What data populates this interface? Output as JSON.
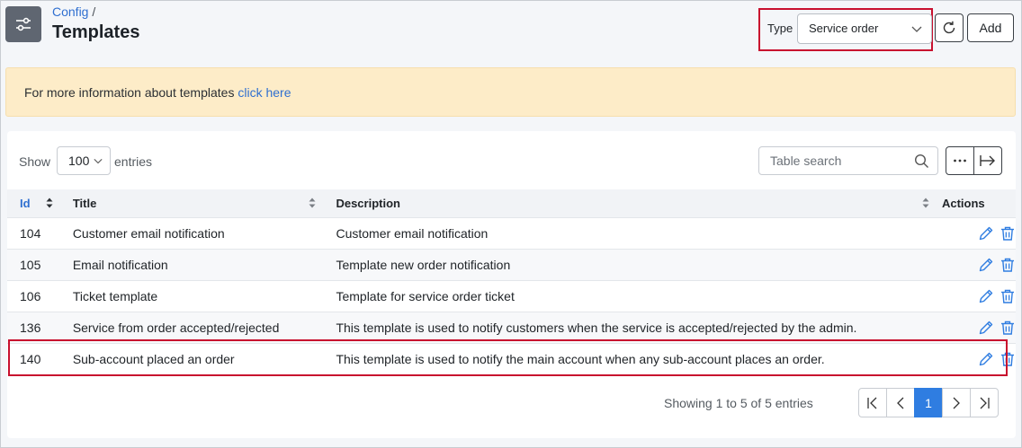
{
  "header": {
    "breadcrumb_parent": "Config",
    "breadcrumb_sep": "/",
    "title": "Templates",
    "type_label": "Type",
    "type_value": "Service order",
    "add_label": "Add"
  },
  "alert": {
    "text": "For more information about templates ",
    "link": "click here"
  },
  "table_controls": {
    "show_label": "Show",
    "page_length": "100",
    "entries_label": "entries",
    "search_placeholder": "Table search"
  },
  "columns": {
    "id": "Id",
    "title": "Title",
    "description": "Description",
    "actions": "Actions"
  },
  "rows": [
    {
      "id": "104",
      "title": "Customer email notification",
      "description": "Customer email notification"
    },
    {
      "id": "105",
      "title": "Email notification",
      "description": "Template new order notification"
    },
    {
      "id": "106",
      "title": "Ticket template",
      "description": "Template for service order ticket"
    },
    {
      "id": "136",
      "title": "Service from order accepted/rejected",
      "description": "This template is used to notify customers when the service is accepted/rejected by the admin."
    },
    {
      "id": "140",
      "title": "Sub-account placed an order",
      "description": "This template is used to notify the main account when any sub-account places an order."
    }
  ],
  "footer": {
    "info": "Showing 1 to 5 of 5 entries",
    "current_page": "1"
  },
  "icons": {
    "menu": "sliders-icon",
    "refresh": "refresh-icon",
    "search": "search-icon",
    "edit": "pencil-icon",
    "delete": "trash-icon"
  },
  "colors": {
    "accent": "#2f7de1",
    "highlight": "#c8102e",
    "alert_bg": "#fdecc8"
  }
}
